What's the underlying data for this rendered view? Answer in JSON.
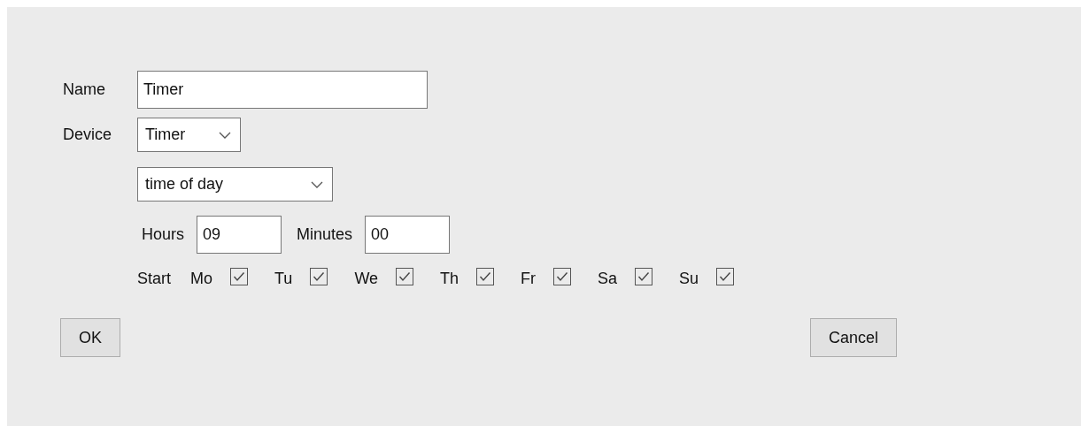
{
  "name": {
    "label": "Name",
    "value": "Timer"
  },
  "device": {
    "label": "Device",
    "value": "Timer"
  },
  "mode": {
    "value": "time of day"
  },
  "hours": {
    "label": "Hours",
    "value": "09"
  },
  "minutes": {
    "label": "Minutes",
    "value": "00"
  },
  "start": {
    "label": "Start",
    "days": [
      {
        "label": "Mo",
        "checked": true
      },
      {
        "label": "Tu",
        "checked": true
      },
      {
        "label": "We",
        "checked": true
      },
      {
        "label": "Th",
        "checked": true
      },
      {
        "label": "Fr",
        "checked": true
      },
      {
        "label": "Sa",
        "checked": true
      },
      {
        "label": "Su",
        "checked": true
      }
    ]
  },
  "buttons": [
    {
      "label": "OK"
    },
    {
      "label": "Cancel"
    }
  ]
}
